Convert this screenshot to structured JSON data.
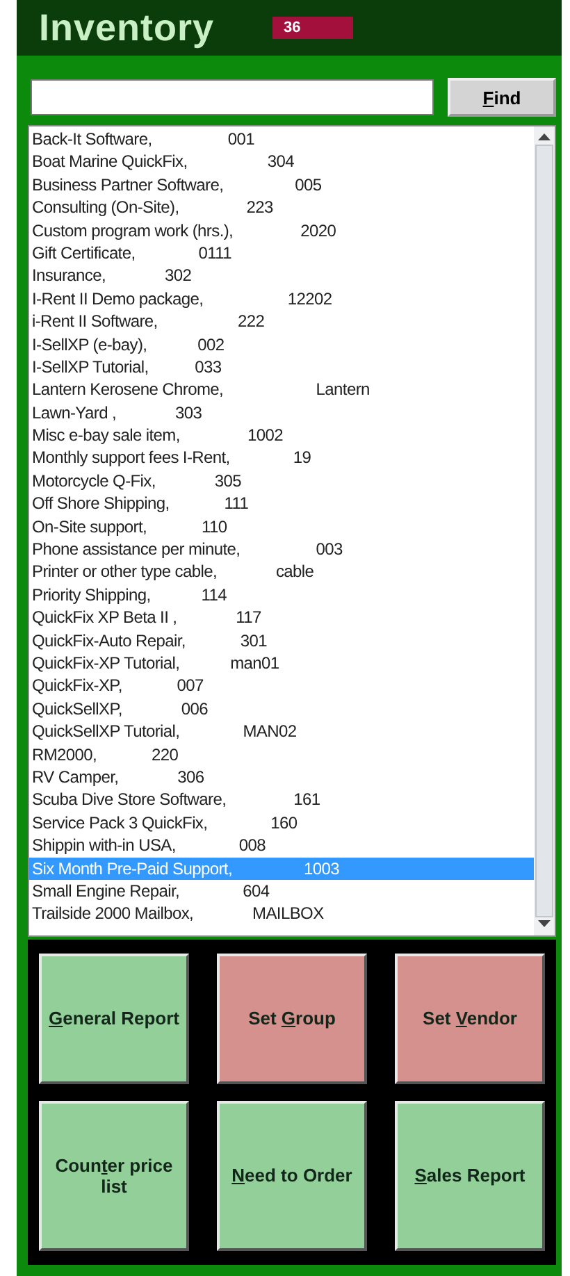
{
  "window": {
    "title": "Inventory",
    "badge": "36"
  },
  "search": {
    "button": {
      "key": "F",
      "post": "ind"
    }
  },
  "list": [
    {
      "text": "Back-It Software,                  001",
      "selected": false
    },
    {
      "text": "Boat Marine QuickFix,                   304",
      "selected": false
    },
    {
      "text": "Business Partner Software,                 005",
      "selected": false
    },
    {
      "text": "Consulting (On-Site),                223",
      "selected": false
    },
    {
      "text": "Custom program work (hrs.),                2020",
      "selected": false
    },
    {
      "text": "Gift Certificate,               0111",
      "selected": false
    },
    {
      "text": "Insurance,              302",
      "selected": false
    },
    {
      "text": "I-Rent II Demo package,                    12202",
      "selected": false
    },
    {
      "text": "i-Rent II Software,                   222",
      "selected": false
    },
    {
      "text": "I-SellXP (e-bay),            002",
      "selected": false
    },
    {
      "text": "I-SellXP Tutorial,           033",
      "selected": false
    },
    {
      "text": "Lantern Kerosene Chrome,                      Lantern",
      "selected": false
    },
    {
      "text": "Lawn-Yard ,              303",
      "selected": false
    },
    {
      "text": "Misc e-bay sale item,                1002",
      "selected": false
    },
    {
      "text": "Monthly support fees I-Rent,               19",
      "selected": false
    },
    {
      "text": "Motorcycle Q-Fix,              305",
      "selected": false
    },
    {
      "text": "Off Shore Shipping,             111",
      "selected": false
    },
    {
      "text": "On-Site support,             110",
      "selected": false
    },
    {
      "text": "Phone assistance per minute,                  003",
      "selected": false
    },
    {
      "text": "Printer or other type cable,              cable",
      "selected": false
    },
    {
      "text": "Priority Shipping,            114",
      "selected": false
    },
    {
      "text": "QuickFix XP Beta II ,              117",
      "selected": false
    },
    {
      "text": "QuickFix-Auto Repair,             301",
      "selected": false
    },
    {
      "text": "QuickFix-XP Tutorial,            man01",
      "selected": false
    },
    {
      "text": "QuickFix-XP,             007",
      "selected": false
    },
    {
      "text": "QuickSellXP,              006",
      "selected": false
    },
    {
      "text": "QuickSellXP Tutorial,               MAN02",
      "selected": false
    },
    {
      "text": "RM2000,             220",
      "selected": false
    },
    {
      "text": "RV Camper,              306",
      "selected": false
    },
    {
      "text": "Scuba Dive Store Software,                161",
      "selected": false
    },
    {
      "text": "Service Pack 3 QuickFix,               160",
      "selected": false
    },
    {
      "text": "Shippin with-in USA,               008",
      "selected": false
    },
    {
      "text": "Six Month Pre-Paid Support,                 1003",
      "selected": true
    },
    {
      "text": "Small Engine Repair,               604",
      "selected": false
    },
    {
      "text": "Trailside 2000 Mailbox,              MAILBOX",
      "selected": false
    }
  ],
  "buttons": [
    {
      "kind": "green",
      "key": "G",
      "post": "eneral Report"
    },
    {
      "kind": "red",
      "pre": "Set ",
      "key": "G",
      "post": "roup"
    },
    {
      "kind": "red",
      "pre": "Set ",
      "key": "V",
      "post": "endor"
    },
    {
      "kind": "green",
      "pre": "Coun",
      "key": "t",
      "post": "er price list"
    },
    {
      "kind": "green",
      "key": "N",
      "post": "eed to Order"
    },
    {
      "kind": "green",
      "key": "S",
      "post": "ales Report"
    }
  ]
}
